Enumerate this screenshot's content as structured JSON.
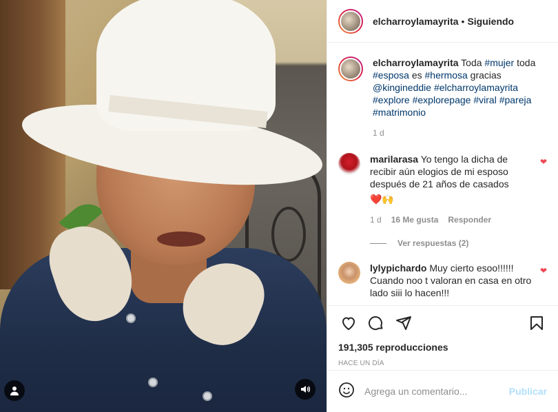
{
  "post": {
    "username": "elcharroylamayrita",
    "separator": "•",
    "follow_status": "Siguiendo"
  },
  "caption": {
    "username": "elcharroylamayrita",
    "parts": [
      {
        "text": "Toda ",
        "tag": false
      },
      {
        "text": "#mujer",
        "tag": true
      },
      {
        "text": " toda ",
        "tag": false
      },
      {
        "text": "#esposa",
        "tag": true
      },
      {
        "text": " es ",
        "tag": false
      },
      {
        "text": "#hermosa",
        "tag": true
      },
      {
        "text": " gracias ",
        "tag": false
      },
      {
        "text": "@kingineddie",
        "tag": true
      },
      {
        "text": " ",
        "tag": false
      },
      {
        "text": "#elcharroylamayrita",
        "tag": true
      },
      {
        "text": " ",
        "tag": false
      },
      {
        "text": "#explore",
        "tag": true
      },
      {
        "text": " ",
        "tag": false
      },
      {
        "text": "#explorepage",
        "tag": true
      },
      {
        "text": " ",
        "tag": false
      },
      {
        "text": "#viral",
        "tag": true
      },
      {
        "text": " ",
        "tag": false
      },
      {
        "text": "#pareja",
        "tag": true
      },
      {
        "text": " ",
        "tag": false
      },
      {
        "text": "#matrimonio",
        "tag": true
      }
    ],
    "age": "1 d"
  },
  "comments": [
    {
      "username": "marilarasa",
      "text": "Yo tengo la dicha de recibir aún elogios de mi esposo después de 21 años de casados",
      "emoji": "❤️🙌",
      "age": "1 d",
      "likes": "16 Me gusta",
      "reply_label": "Responder",
      "view_replies": "Ver respuestas (2)"
    },
    {
      "username": "lylypichardo",
      "text": "Muy cierto esoo!!!!!! Cuando noo t valoran en casa en otro lado siii lo hacen!!!"
    }
  ],
  "actions": {
    "views": "191,305 reproducciones",
    "posted": "HACE UN DÍA"
  },
  "add_comment": {
    "placeholder": "Agrega un comentario...",
    "publish_label": "Publicar"
  },
  "icons": [
    "heart-icon",
    "comment-icon",
    "share-icon",
    "bookmark-icon",
    "emoji-icon",
    "user-tag-icon",
    "sound-icon"
  ],
  "colors": {
    "link": "#00376b",
    "like_red": "#ed4956",
    "publish_disabled": "#b2dffc",
    "muted": "#8e8e8e"
  }
}
